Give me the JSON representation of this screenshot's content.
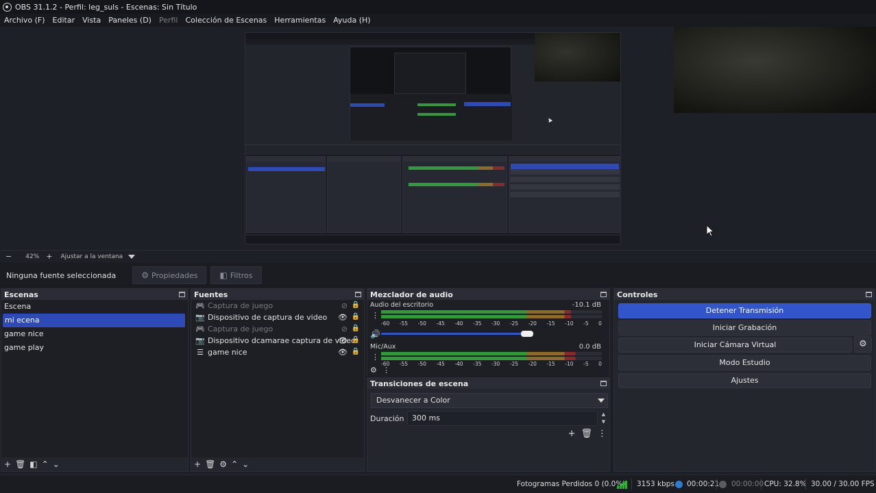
{
  "window": {
    "title": "OBS 31.1.2 - Perfil: leg_suls - Escenas: Sin Título"
  },
  "menu": [
    "Archivo (F)",
    "Editar",
    "Vista",
    "Paneles (D)",
    "Perfil",
    "Colección de Escenas",
    "Herramientas",
    "Ayuda (H)"
  ],
  "zoombar": {
    "minus": "−",
    "zoom": "42%",
    "plus": "+",
    "fit_label": "Ajustar a la ventana"
  },
  "context": {
    "no_selection": "Ninguna fuente seleccionada",
    "properties": "Propiedades",
    "filters": "Filtros"
  },
  "scenes": {
    "title": "Escenas",
    "items": [
      "Escena",
      "mi ecena",
      "game nice",
      "game play"
    ],
    "selected_index": 1
  },
  "sources": {
    "title": "Fuentes",
    "items": [
      {
        "label": "Captura de juego",
        "icon": "gamepad-icon",
        "visible": false
      },
      {
        "label": "Dispositivo de captura de video",
        "icon": "camera-icon",
        "visible": true
      },
      {
        "label": "Captura de juego",
        "icon": "gamepad-icon",
        "visible": false
      },
      {
        "label": "Dispositivo dcamarae captura de video",
        "icon": "camera-icon",
        "visible": true
      },
      {
        "label": "game nice",
        "icon": "list-icon",
        "visible": true
      }
    ]
  },
  "mixer": {
    "title": "Mezclador de audio",
    "channels": [
      {
        "name": "Audio del escritorio",
        "db": "-10.1 dB",
        "level": 0.86,
        "volume": 0.66
      },
      {
        "name": "Mic/Aux",
        "db": "0.0 dB",
        "level": 0.88,
        "volume": 1.0
      }
    ],
    "ticks": [
      "-60",
      "-55",
      "-50",
      "-45",
      "-40",
      "-35",
      "-30",
      "-25",
      "-20",
      "-15",
      "-10",
      "-5",
      "0"
    ]
  },
  "transitions": {
    "title": "Transiciones de escena",
    "selected": "Desvanecer a Color",
    "duration_label": "Duración",
    "duration_value": "300 ms"
  },
  "controls": {
    "title": "Controles",
    "stop_stream": "Detener Transmisión",
    "start_recording": "Iniciar Grabación",
    "start_virtual_cam": "Iniciar Cámara Virtual",
    "studio_mode": "Modo Estudio",
    "settings": "Ajustes"
  },
  "status": {
    "dropped_frames": "Fotogramas Perdidos 0 (0.0%)",
    "bitrate": "3153 kbps",
    "stream_time": "00:00:21",
    "rec_time": "00:00:00",
    "cpu": "CPU: 32.8%",
    "fps": "30.00 / 30.00 FPS"
  },
  "colors": {
    "accent": "#3255cc",
    "meter_green": "#2f9b3a",
    "meter_yellow": "#8d6b24",
    "meter_red": "#8a2a2a",
    "stream_dot": "#2f7bd0",
    "rec_dot": "#5a5c62"
  }
}
